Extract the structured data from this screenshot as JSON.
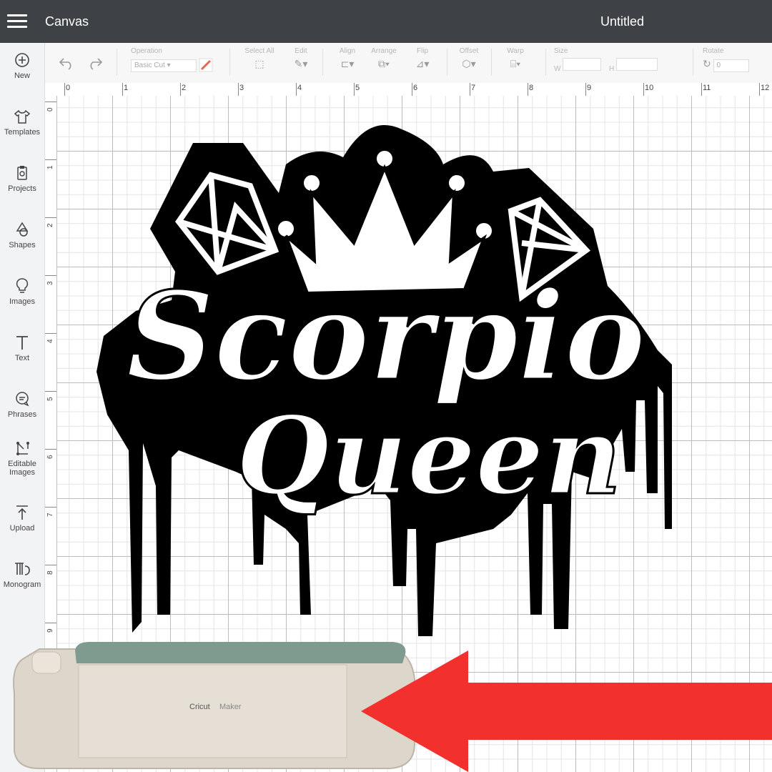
{
  "header": {
    "app_name": "Canvas",
    "document_title": "Untitled"
  },
  "sidebar": {
    "items": [
      {
        "label": "New",
        "icon": "plus-circle-icon"
      },
      {
        "label": "Templates",
        "icon": "tshirt-icon"
      },
      {
        "label": "Projects",
        "icon": "clipboard-icon"
      },
      {
        "label": "Shapes",
        "icon": "shapes-icon"
      },
      {
        "label": "Images",
        "icon": "lightbulb-icon"
      },
      {
        "label": "Text",
        "icon": "text-t-icon"
      },
      {
        "label": "Phrases",
        "icon": "speech-bubble-icon"
      },
      {
        "label": "Editable Images",
        "icon": "editable-image-icon"
      },
      {
        "label": "Upload",
        "icon": "upload-arrow-icon"
      },
      {
        "label": "Monogram",
        "icon": "monogram-icon"
      }
    ]
  },
  "toolbar": {
    "operation_label": "Operation",
    "operation_value": "Basic Cut",
    "select_all_label": "Select All",
    "edit_label": "Edit",
    "align_label": "Align",
    "arrange_label": "Arrange",
    "flip_label": "Flip",
    "offset_label": "Offset",
    "warp_label": "Warp",
    "size_label": "Size",
    "width_label": "W",
    "height_label": "H",
    "rotate_label": "Rotate",
    "rotate_value": "0"
  },
  "ruler": {
    "top_ticks": [
      "0",
      "1",
      "2",
      "3",
      "4",
      "5",
      "6",
      "7",
      "8",
      "9",
      "10",
      "11",
      "12"
    ],
    "left_ticks": [
      "0",
      "1",
      "2",
      "3",
      "4",
      "5",
      "6",
      "7",
      "8",
      "9"
    ]
  },
  "design": {
    "line1": "Scorpio",
    "line2": "Queen"
  },
  "machine": {
    "brand": "Cricut",
    "model": "Maker"
  },
  "colors": {
    "header": "#3e4145",
    "arrow": "#f2302e",
    "design": "#000000",
    "machine_lid": "#7f9a8f"
  }
}
